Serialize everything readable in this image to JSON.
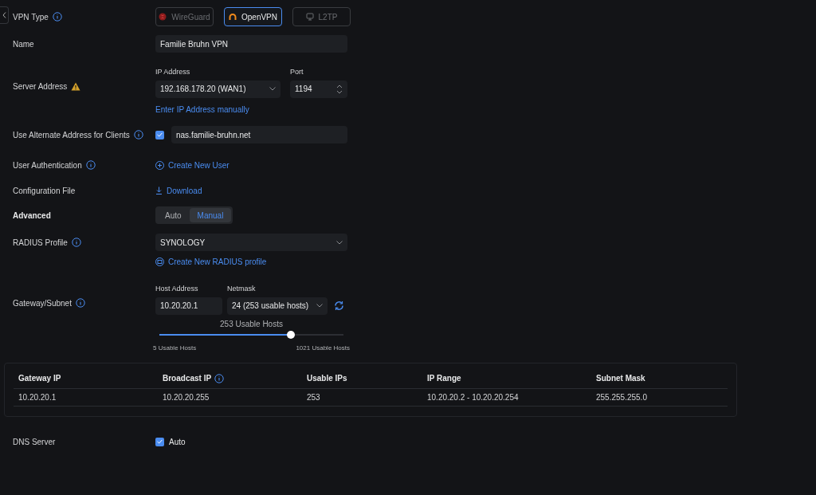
{
  "vpn_type": {
    "label": "VPN Type",
    "options": [
      {
        "label": "WireGuard",
        "selected": false,
        "disabled": true
      },
      {
        "label": "OpenVPN",
        "selected": true,
        "disabled": false
      },
      {
        "label": "L2TP",
        "selected": false,
        "disabled": true
      }
    ]
  },
  "name": {
    "label": "Name",
    "value": "Familie Bruhn VPN"
  },
  "server_address": {
    "label": "Server Address",
    "ip_label": "IP Address",
    "ip_value": "192.168.178.20 (WAN1)",
    "port_label": "Port",
    "port_value": "1194",
    "link": "Enter IP Address manually"
  },
  "alternate_address": {
    "label": "Use Alternate Address for Clients",
    "checked": true,
    "value": "nas.familie-bruhn.net"
  },
  "user_authentication": {
    "label": "User Authentication",
    "link": "Create New User"
  },
  "configuration_file": {
    "label": "Configuration File",
    "link": "Download"
  },
  "advanced": {
    "label": "Advanced",
    "options": [
      {
        "label": "Auto",
        "selected": false
      },
      {
        "label": "Manual",
        "selected": true
      }
    ]
  },
  "radius_profile": {
    "label": "RADIUS Profile",
    "value": "SYNOLOGY",
    "link": "Create New RADIUS profile"
  },
  "gateway_subnet": {
    "label": "Gateway/Subnet",
    "host_label": "Host Address",
    "host_value": "10.20.20.1",
    "netmask_label": "Netmask",
    "netmask_value": "24 (253 usable hosts)",
    "slider_reading": "253 Usable Hosts",
    "level": 0.716,
    "min_label": "5 Usable Hosts",
    "max_label": "1021 Usable Hosts"
  },
  "table": {
    "columns": [
      {
        "label": "Gateway IP",
        "info": false
      },
      {
        "label": "Broadcast IP",
        "info": true
      },
      {
        "label": "Usable IPs",
        "info": false
      },
      {
        "label": "IP Range",
        "info": false
      },
      {
        "label": "Subnet Mask",
        "info": false
      }
    ],
    "rows": [
      [
        "10.20.20.1",
        "10.20.20.255",
        "253",
        "10.20.20.2 - 10.20.20.254",
        "255.255.255.0"
      ]
    ]
  },
  "dns_server": {
    "label": "DNS Server",
    "checked": true,
    "option": "Auto"
  }
}
